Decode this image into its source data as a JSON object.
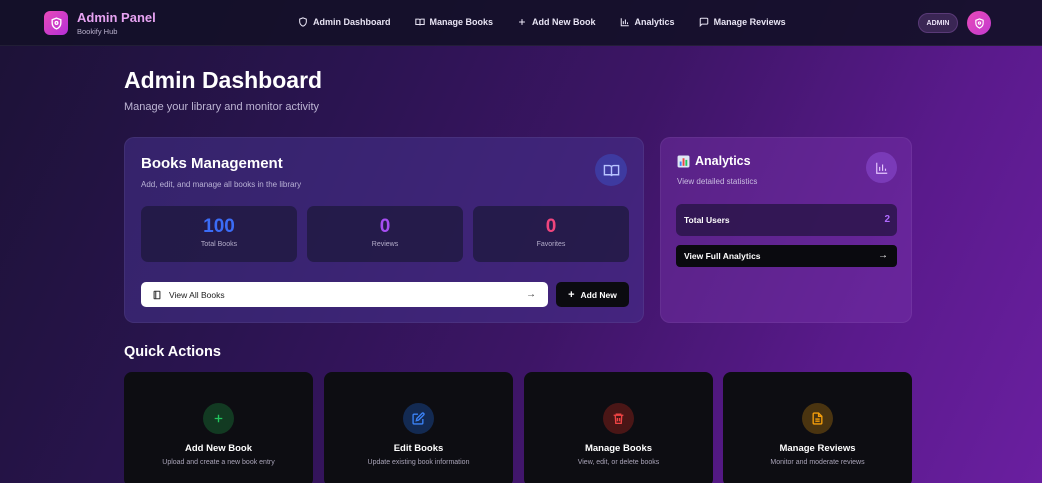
{
  "nav": {
    "brand_title": "Admin Panel",
    "brand_sub": "Bookify Hub",
    "links": [
      {
        "label": "Admin Dashboard",
        "icon": "shield-icon"
      },
      {
        "label": "Manage Books",
        "icon": "book-open-icon"
      },
      {
        "label": "Add New Book",
        "icon": "plus-icon"
      },
      {
        "label": "Analytics",
        "icon": "bar-chart-icon"
      },
      {
        "label": "Manage Reviews",
        "icon": "message-icon"
      }
    ],
    "role_badge": "ADMIN"
  },
  "header": {
    "title": "Admin Dashboard",
    "subtitle": "Manage your library and monitor activity"
  },
  "books_card": {
    "title": "Books Management",
    "subtitle": "Add, edit, and manage all books in the library",
    "stats": [
      {
        "value": "100",
        "label": "Total Books",
        "color": "#3b6cf6"
      },
      {
        "value": "0",
        "label": "Reviews",
        "color": "#a64df2"
      },
      {
        "value": "0",
        "label": "Favorites",
        "color": "#f0457d"
      }
    ],
    "view_all_label": "View All Books",
    "add_new_label": "Add New"
  },
  "analytics_card": {
    "title": "Analytics",
    "subtitle": "View detailed statistics",
    "total_users_label": "Total Users",
    "total_users_value": "2",
    "full_analytics_label": "View Full Analytics"
  },
  "quick_actions": {
    "title": "Quick Actions",
    "items": [
      {
        "name": "Add New Book",
        "desc": "Upload and create a new book entry",
        "icon": "plus-icon",
        "color": "#22c55e",
        "bg": "#123a22"
      },
      {
        "name": "Edit Books",
        "desc": "Update existing book information",
        "icon": "edit-icon",
        "color": "#3b82f6",
        "bg": "#132a52"
      },
      {
        "name": "Manage Books",
        "desc": "View, edit, or delete books",
        "icon": "trash-icon",
        "color": "#ef4444",
        "bg": "#4a1616"
      },
      {
        "name": "Manage Reviews",
        "desc": "Monitor and moderate reviews",
        "icon": "document-icon",
        "color": "#f59e0b",
        "bg": "#4a3410"
      }
    ]
  }
}
